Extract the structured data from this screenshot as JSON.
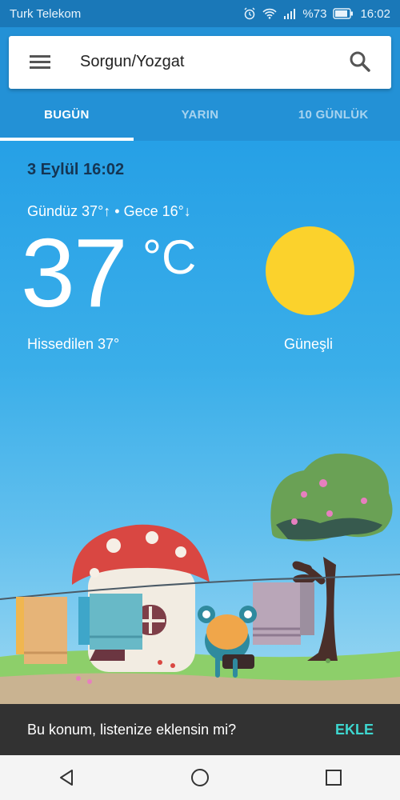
{
  "status_bar": {
    "carrier": "Turk Telekom",
    "battery": "%73",
    "time": "16:02",
    "icons": [
      "alarm-icon",
      "wifi-icon",
      "signal-icon",
      "battery-icon"
    ]
  },
  "search": {
    "location": "Sorgun/Yozgat",
    "menu_icon": "hamburger-icon",
    "search_icon": "search-icon"
  },
  "tabs": [
    {
      "label": "BUGÜN",
      "active": true
    },
    {
      "label": "YARIN",
      "active": false
    },
    {
      "label": "10 GÜNLÜK",
      "active": false
    }
  ],
  "weather": {
    "date": "3 Eylül 16:02",
    "day_night": "Gündüz 37°↑ • Gece 16°↓",
    "temperature": "37",
    "unit": "°C",
    "feels_like": "Hissedilen 37°",
    "condition": "Güneşli",
    "condition_icon": "sun-icon"
  },
  "snackbar": {
    "message": "Bu konum, listenize eklensin mi?",
    "action": "EKLE"
  },
  "navbar": {
    "icons": [
      "back-icon",
      "home-icon",
      "recents-icon"
    ]
  },
  "colors": {
    "status_bar": "#1a78b8",
    "header": "#2391d6",
    "sun": "#fbd22c",
    "snackbar": "#323232",
    "accent": "#3ed7d0"
  }
}
